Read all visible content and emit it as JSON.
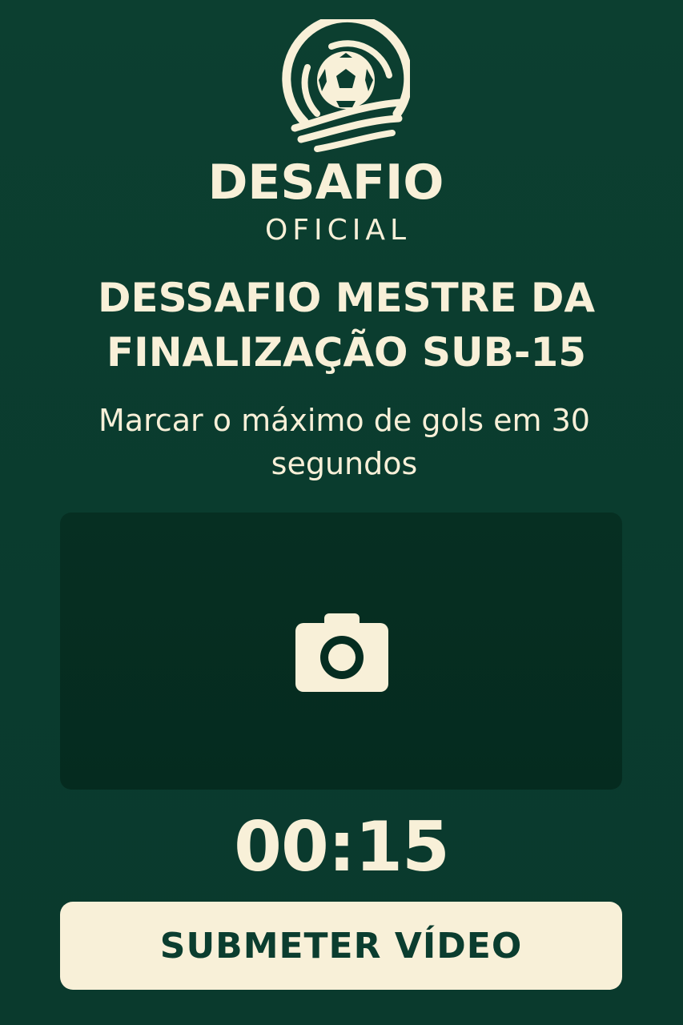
{
  "colors": {
    "background": "#0b3d2f",
    "panel": "#052d21",
    "cream": "#f8f0d8",
    "button_text": "#0b3d2f"
  },
  "brand": {
    "icon": "soccer-ball-emblem-icon",
    "title": "DESAFIO",
    "subtitle": "OFICIAL"
  },
  "challenge": {
    "title": "DESSAFIO MESTRE DA FINALIZAÇÃO SUB-15",
    "description": "Marcar o máximo de gols em 30 segundos"
  },
  "camera": {
    "icon": "camera-icon"
  },
  "timer": {
    "value": "00:15"
  },
  "actions": {
    "submit_label": "SUBMETER VÍDEO"
  }
}
